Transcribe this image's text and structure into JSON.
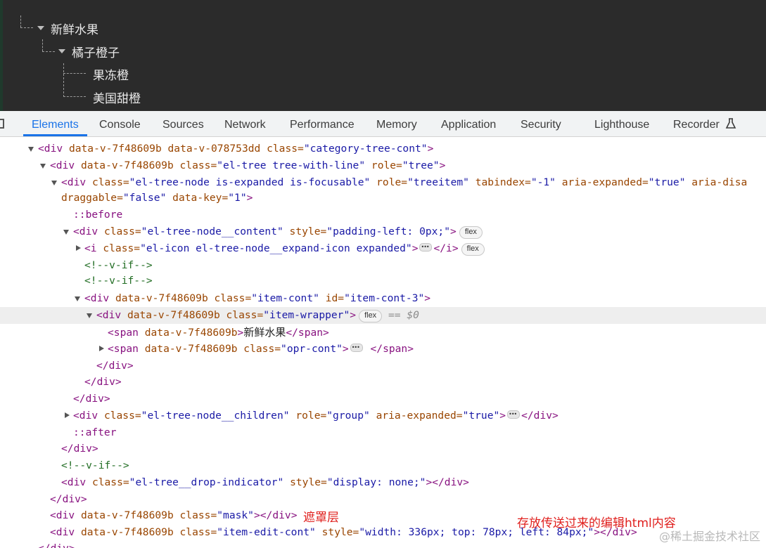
{
  "preview": {
    "nodes": [
      "新鲜水果",
      "橘子橙子",
      "果冻橙",
      "美国甜橙"
    ]
  },
  "tabs": [
    "Elements",
    "Console",
    "Sources",
    "Network",
    "Performance",
    "Memory",
    "Application",
    "Security",
    "Lighthouse",
    "Recorder"
  ],
  "active_tab": "Elements",
  "dom": {
    "l1": {
      "open": "<div",
      "a1": " data-v-7f48609b data-v-078753dd class=",
      "v1": "\"category-tree-cont\"",
      "close": ">"
    },
    "l2": {
      "open": "<div",
      "a1": " data-v-7f48609b class=",
      "v1": "\"el-tree tree-with-line\"",
      "a2": " role=",
      "v2": "\"tree\"",
      "close": ">"
    },
    "l3": {
      "open": "<div",
      "a1": " class=",
      "v1": "\"el-tree-node is-expanded is-focusable\"",
      "a2": " role=",
      "v2": "\"treeitem\"",
      "a3": " tabindex=",
      "v3": "\"-1\"",
      "a4": " aria-expanded=",
      "v4": "\"true\"",
      "a5": " aria-disa"
    },
    "l4": {
      "a1": "draggable=",
      "v1": "\"false\"",
      "a2": " data-key=",
      "v2": "\"1\"",
      "close": ">"
    },
    "l5": "::before",
    "l6": {
      "open": "<div",
      "a1": " class=",
      "v1": "\"el-tree-node__content\"",
      "a2": " style=",
      "v2": "\"padding-left: 0px;\"",
      "close": ">",
      "badge": "flex"
    },
    "l7": {
      "open": "<i",
      "a1": " class=",
      "v1": "\"el-icon el-tree-node__expand-icon expanded\"",
      "close": ">",
      "end": "</i>",
      "badge": "flex"
    },
    "l8": "<!--v-if-->",
    "l9": "<!--v-if-->",
    "l10": {
      "open": "<div",
      "a1": " data-v-7f48609b class=",
      "v1": "\"item-cont\"",
      "a2": " id=",
      "v2": "\"item-cont-3\"",
      "close": ">"
    },
    "l11": {
      "open": "<div",
      "a1": " data-v-7f48609b class=",
      "v1": "\"item-wrapper\"",
      "close": ">",
      "badge": "flex",
      "sel": "== $0"
    },
    "l12": {
      "open": "<span",
      "a1": " data-v-7f48609b",
      "close": ">",
      "text": "新鲜水果",
      "end": "</span>"
    },
    "l13": {
      "open": "<span",
      "a1": " data-v-7f48609b class=",
      "v1": "\"opr-cont\"",
      "close": ">",
      "end": "</span>"
    },
    "l14": "</div>",
    "l15": "</div>",
    "l16": "</div>",
    "l17": {
      "open": "<div",
      "a1": " class=",
      "v1": "\"el-tree-node__children\"",
      "a2": " role=",
      "v2": "\"group\"",
      "a3": " aria-expanded=",
      "v3": "\"true\"",
      "close": ">",
      "end": "</div>"
    },
    "l18": "::after",
    "l19": "</div>",
    "l20": "<!--v-if-->",
    "l21": {
      "open": "<div",
      "a1": " class=",
      "v1": "\"el-tree__drop-indicator\"",
      "a2": " style=",
      "v2": "\"display: none;\"",
      "close": ">",
      "end": "</div>"
    },
    "l22": "</div>",
    "l23": {
      "open": "<div",
      "a1": " data-v-7f48609b class=",
      "v1": "\"mask\"",
      "close": ">",
      "end": "</div>"
    },
    "l24": {
      "open": "<div",
      "a1": " data-v-7f48609b class=",
      "v1": "\"item-edit-cont\"",
      "a2": " style=",
      "v2": "\"width: 336px; top: 78px; left: 84px;\"",
      "close": ">",
      "end": "</div>"
    },
    "l25": "</div>"
  },
  "annotations": {
    "mask": "遮罩层",
    "edit": "存放传送过来的编辑html内容"
  },
  "watermark": "@稀土掘金技术社区",
  "colors": {
    "tab_active": "#1a73e8",
    "annotation": "#e0201e",
    "preview_bg": "#2b2b2b"
  }
}
